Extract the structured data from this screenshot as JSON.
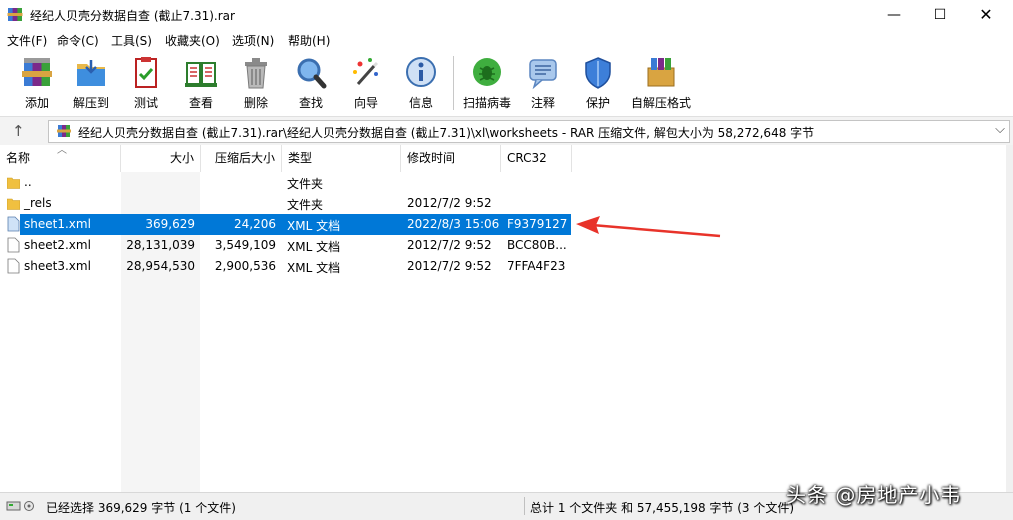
{
  "window": {
    "title": "经纪人贝壳分数据自查 (截止7.31).rar",
    "minimize": "—",
    "maximize": "☐",
    "close": "✕"
  },
  "menu": [
    "文件(F)",
    "命令(C)",
    "工具(S)",
    "收藏夹(O)",
    "选项(N)",
    "帮助(H)"
  ],
  "toolbar": [
    {
      "label": "添加",
      "icon": "add-archive-icon"
    },
    {
      "label": "解压到",
      "icon": "extract-to-icon"
    },
    {
      "label": "测试",
      "icon": "test-icon"
    },
    {
      "label": "查看",
      "icon": "view-icon"
    },
    {
      "label": "删除",
      "icon": "delete-icon"
    },
    {
      "label": "查找",
      "icon": "find-icon"
    },
    {
      "label": "向导",
      "icon": "wizard-icon"
    },
    {
      "label": "信息",
      "icon": "info-icon"
    },
    {
      "label": "扫描病毒",
      "icon": "virus-scan-icon"
    },
    {
      "label": "注释",
      "icon": "comment-icon"
    },
    {
      "label": "保护",
      "icon": "protect-icon"
    },
    {
      "label": "自解压格式",
      "icon": "sfx-icon"
    }
  ],
  "address": {
    "path": "经纪人贝壳分数据自查 (截止7.31).rar\\经纪人贝壳分数据自查 (截止7.31)\\xl\\worksheets - RAR 压缩文件, 解包大小为 58,272,648 字节"
  },
  "columns": [
    "名称",
    "大小",
    "压缩后大小",
    "类型",
    "修改时间",
    "CRC32"
  ],
  "rows": [
    {
      "name": "..",
      "size": "",
      "packed": "",
      "type": "文件夹",
      "modified": "",
      "crc": "",
      "kind": "folder"
    },
    {
      "name": "_rels",
      "size": "",
      "packed": "",
      "type": "文件夹",
      "modified": "2012/7/2 9:52",
      "crc": "",
      "kind": "folder"
    },
    {
      "name": "sheet1.xml",
      "size": "369,629",
      "packed": "24,206",
      "type": "XML 文档",
      "modified": "2022/8/3 15:06",
      "crc": "F9379127",
      "kind": "file",
      "selected": true
    },
    {
      "name": "sheet2.xml",
      "size": "28,131,039",
      "packed": "3,549,109",
      "type": "XML 文档",
      "modified": "2012/7/2 9:52",
      "crc": "BCC80B...",
      "kind": "file"
    },
    {
      "name": "sheet3.xml",
      "size": "28,954,530",
      "packed": "2,900,536",
      "type": "XML 文档",
      "modified": "2012/7/2 9:52",
      "crc": "7FFA4F23",
      "kind": "file"
    }
  ],
  "status": {
    "left": "已经选择 369,629 字节 (1 个文件)",
    "right": "总计 1 个文件夹 和 57,455,198 字节 (3 个文件)"
  },
  "watermark": "头条 @房地产小韦",
  "colors": {
    "selection": "#0078d7",
    "arrow": "#e8332a"
  }
}
